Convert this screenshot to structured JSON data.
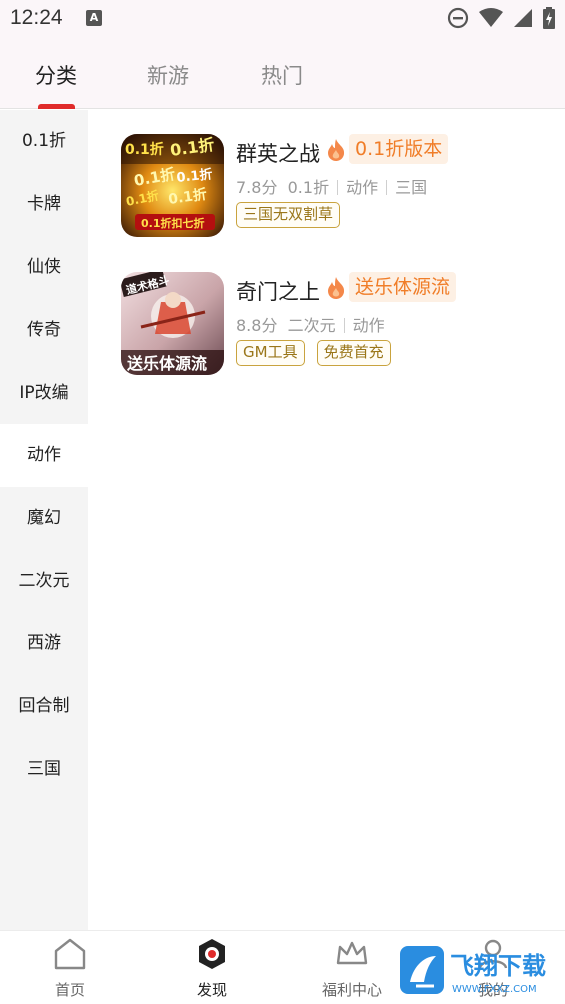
{
  "status_bar": {
    "time": "12:24",
    "notification_icon": "a-app-icon",
    "icons": [
      "do-not-disturb-icon",
      "wifi-icon",
      "signal-icon",
      "battery-charging-icon"
    ]
  },
  "top_tabs": [
    {
      "label": "分类",
      "active": true
    },
    {
      "label": "新游",
      "active": false
    },
    {
      "label": "热门",
      "active": false
    }
  ],
  "sidebar": {
    "items": [
      {
        "label": "0.1折",
        "active": false
      },
      {
        "label": "卡牌",
        "active": false
      },
      {
        "label": "仙侠",
        "active": false
      },
      {
        "label": "传奇",
        "active": false
      },
      {
        "label": "IP改编",
        "active": false
      },
      {
        "label": "动作",
        "active": true
      },
      {
        "label": "魔幻",
        "active": false
      },
      {
        "label": "二次元",
        "active": false
      },
      {
        "label": "西游",
        "active": false
      },
      {
        "label": "回合制",
        "active": false
      },
      {
        "label": "三国",
        "active": false
      }
    ]
  },
  "games": [
    {
      "name": "群英之战",
      "promo": "0.1折版本",
      "score": "7.8分",
      "meta": [
        "0.1折",
        "动作",
        "三国"
      ],
      "tags": [
        "三国无双割草"
      ],
      "icon_text": "0.1折"
    },
    {
      "name": "奇门之上",
      "promo": "送乐体源流",
      "score": "8.8分",
      "meta": [
        "二次元",
        "动作"
      ],
      "tags": [
        "GM工具",
        "免费首充"
      ],
      "icon_text": "送乐体源流",
      "icon_badge": "道术格斗"
    }
  ],
  "bottom_nav": [
    {
      "label": "首页",
      "icon": "home-icon",
      "active": false
    },
    {
      "label": "发现",
      "icon": "discover-icon",
      "active": true
    },
    {
      "label": "福利中心",
      "icon": "crown-icon",
      "active": false
    },
    {
      "label": "我的",
      "icon": "user-icon",
      "active": false
    }
  ],
  "watermark": {
    "text": "飞翔下载",
    "sub": "WWW.FXXZ.COM"
  },
  "colors": {
    "accent_red": "#e02b2b",
    "promo_orange": "#f07d28",
    "tag_gold": "#c9a33e",
    "sidebar_bg": "#f4f4f4"
  }
}
